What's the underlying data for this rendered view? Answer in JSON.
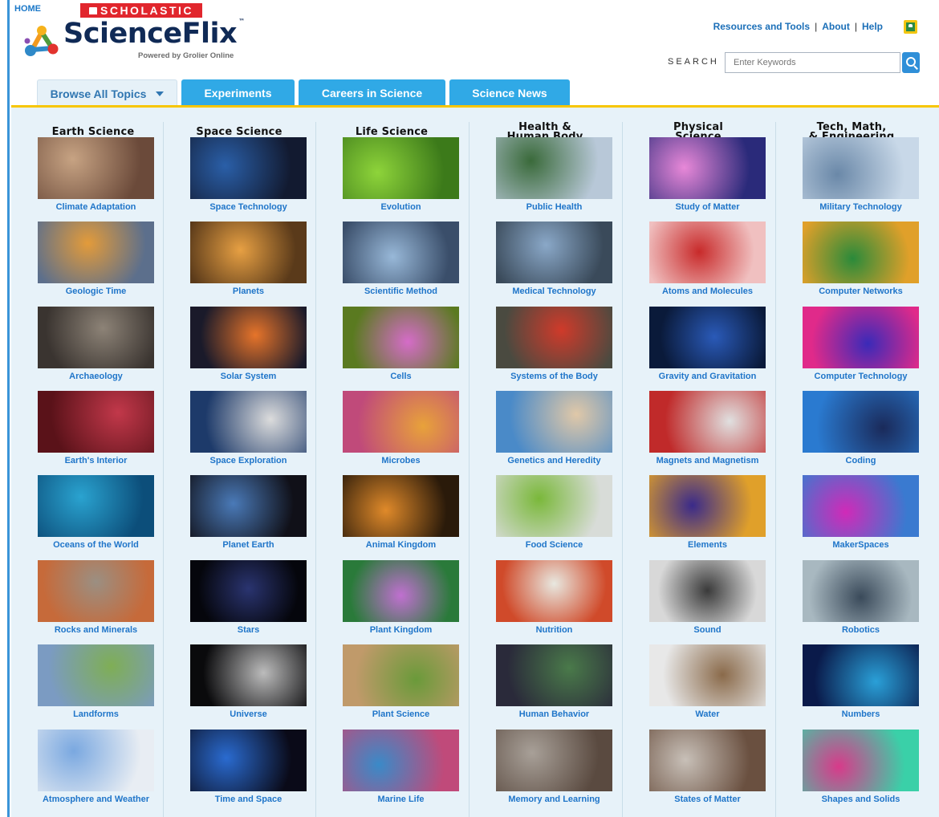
{
  "header": {
    "home_label": "HOME",
    "brand_badge": "SCHOLASTIC",
    "logo_name": "ScienceFlix",
    "logo_tm": "™",
    "logo_tagline": "Powered by Grolier Online",
    "links": [
      "Resources and Tools",
      "About",
      "Help"
    ],
    "link_separator": "|",
    "search_label": "SEARCH",
    "search_placeholder": "Enter Keywords"
  },
  "colors": {
    "accent": "#30a9e6",
    "gold_rule": "#f7c600",
    "link": "#1f75c9",
    "brand_red": "#e1262d",
    "navy": "#102a56"
  },
  "tabs": [
    {
      "label": "Browse All Topics",
      "selected": true
    },
    {
      "label": "Experiments"
    },
    {
      "label": "Careers in Science"
    },
    {
      "label": "Science News"
    }
  ],
  "columns": [
    {
      "heading": [
        "Earth Science"
      ],
      "items": [
        "Climate Adaptation",
        "Geologic Time",
        "Archaeology",
        "Earth's Interior",
        "Oceans of the World",
        "Rocks and Minerals",
        "Landforms",
        "Atmosphere and Weather"
      ]
    },
    {
      "heading": [
        "Space Science"
      ],
      "items": [
        "Space Technology",
        "Planets",
        "Solar System",
        "Space Exploration",
        "Planet Earth",
        "Stars",
        "Universe",
        "Time and Space"
      ]
    },
    {
      "heading": [
        "Life Science"
      ],
      "items": [
        "Evolution",
        "Scientific Method",
        "Cells",
        "Microbes",
        "Animal Kingdom",
        "Plant Kingdom",
        "Plant Science",
        "Marine Life"
      ]
    },
    {
      "heading": [
        "Health &",
        "Human Body"
      ],
      "items": [
        "Public Health",
        "Medical Technology",
        "Systems of the Body",
        "Genetics and Heredity",
        "Food Science",
        "Nutrition",
        "Human Behavior",
        "Memory and Learning"
      ]
    },
    {
      "heading": [
        "Physical",
        "Science"
      ],
      "items": [
        "Study of Matter",
        "Atoms and Molecules",
        "Gravity and Gravitation",
        "Magnets and Magnetism",
        "Elements",
        "Sound",
        "Water",
        "States of Matter"
      ]
    },
    {
      "heading": [
        "Tech, Math,",
        "& Engineering"
      ],
      "items": [
        "Military Technology",
        "Computer Networks",
        "Computer Technology",
        "Coding",
        "MakerSpaces",
        "Robotics",
        "Numbers",
        "Shapes and Solids"
      ]
    }
  ]
}
